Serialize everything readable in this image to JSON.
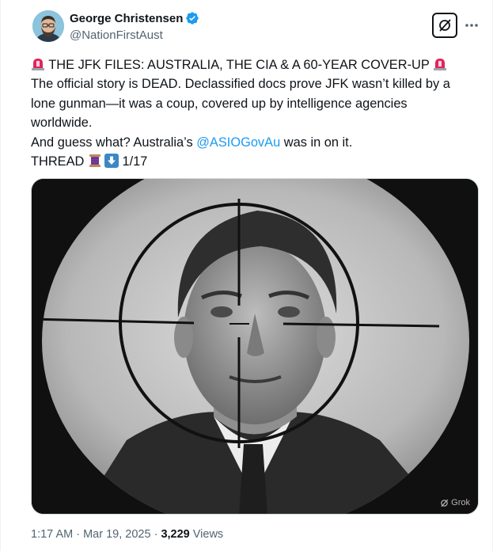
{
  "author": {
    "display_name": "George Christensen",
    "handle": "@NationFirstAust",
    "avatar_icon": "avatar-bearded-man",
    "verified_icon": "verified-badge-icon",
    "verified_color": "#1d9bf0"
  },
  "post": {
    "line1_text": " THE JFK FILES: AUSTRALIA, THE CIA & A 60-YEAR COVER-UP ",
    "line2_text": "The official story is DEAD. Declassified docs prove JFK wasn’t killed by a",
    "line3_text": "lone gunman—it was a coup, covered up by intelligence agencies",
    "line4_text": "worldwide.",
    "line5_prefix": "And guess what? Australia’s ",
    "line5_mention": "@ASIOGovAu",
    "line5_suffix": " was in on it.",
    "line6_prefix": "THREAD ",
    "line6_suffix": " 1/17",
    "emoji_icons": [
      "rotating-light-icon",
      "thread-spool-icon",
      "down-arrow-icon"
    ]
  },
  "media": {
    "description_icon": "jfk-crosshair-image",
    "watermark": "Grok"
  },
  "meta": {
    "time": "1:17 AM",
    "separator": " · ",
    "date": "Mar 19, 2025",
    "views_count": "3,229",
    "views_label": " Views"
  },
  "colors": {
    "text": "#0f1419",
    "secondary": "#536471",
    "accent": "#1d9bf0",
    "siren_red": "#e0245e"
  }
}
